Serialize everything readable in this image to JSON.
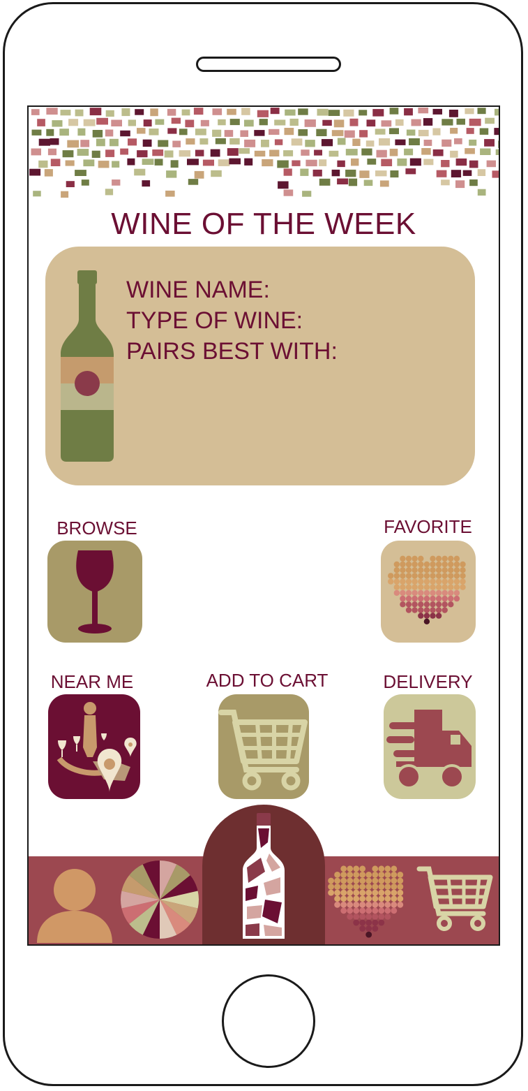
{
  "header": {
    "title": "WINE OF THE WEEK"
  },
  "featured": {
    "lines": [
      "WINE NAME:",
      "TYPE OF WINE:",
      "PAIRS BEST WITH:"
    ]
  },
  "tiles": {
    "browse": "BROWSE",
    "favorite": "FAVORITE",
    "near_me": "NEAR ME",
    "add_to_cart": "ADD TO CART",
    "delivery": "DELIVERY"
  },
  "colors": {
    "brand": "#6b0f33",
    "card": "#d4be96",
    "tile_olive": "#a89a68",
    "tile_cream": "#ccc89a",
    "nav_bar": "#9c4850",
    "nav_center": "#6e2f30"
  },
  "nav": {
    "items": [
      {
        "icon": "profile-icon"
      },
      {
        "icon": "wine-wheel-icon"
      },
      {
        "icon": "wine-bottle-map-icon"
      },
      {
        "icon": "favorites-heart-icon"
      },
      {
        "icon": "cart-icon"
      }
    ]
  }
}
